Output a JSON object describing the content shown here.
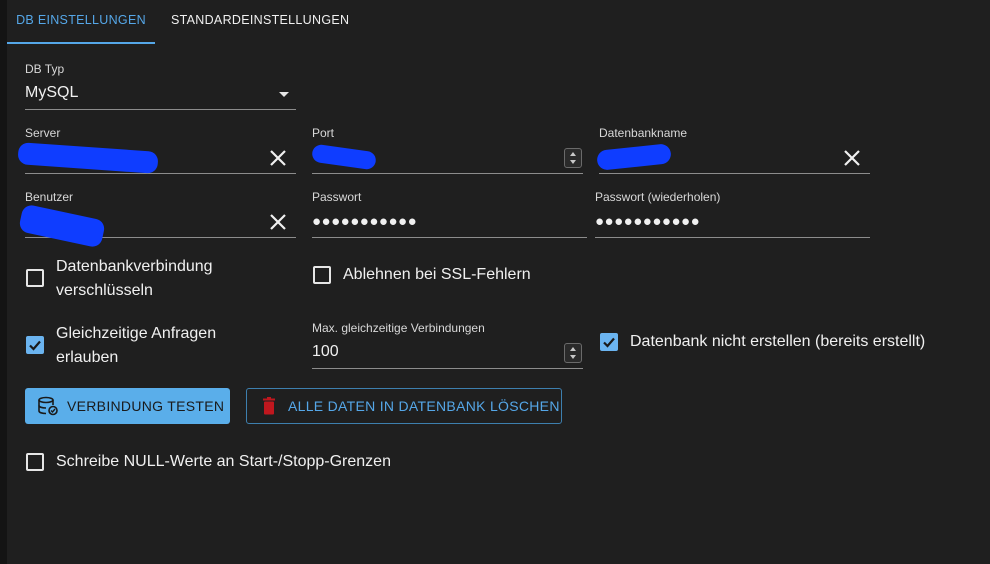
{
  "tabs": [
    {
      "label": "DB EINSTELLUNGEN"
    },
    {
      "label": "STANDARDEINSTELLUNGEN"
    }
  ],
  "db_type": {
    "label": "DB Typ",
    "value": "MySQL"
  },
  "server": {
    "label": "Server"
  },
  "port": {
    "label": "Port"
  },
  "dbname": {
    "label": "Datenbankname"
  },
  "user": {
    "label": "Benutzer"
  },
  "password": {
    "label": "Passwort",
    "value": "●●●●●●●●●●●"
  },
  "password_repeat": {
    "label": "Passwort (wiederholen)",
    "value": "●●●●●●●●●●●"
  },
  "checkboxes": {
    "encrypt": {
      "label_line1": "Datenbankverbindung",
      "label_line2": "verschlüsseln",
      "checked": false
    },
    "ssl": {
      "label": "Ablehnen bei SSL-Fehlern",
      "checked": false
    },
    "concurrent": {
      "label_line1": "Gleichzeitige Anfragen",
      "label_line2": "erlauben",
      "checked": true
    },
    "no_create": {
      "label": "Datenbank nicht erstellen (bereits erstellt)",
      "checked": true
    },
    "null_values": {
      "label": "Schreibe NULL-Werte an Start-/Stopp-Grenzen",
      "checked": false
    }
  },
  "max_connections": {
    "label": "Max. gleichzeitige Verbindungen",
    "value": "100"
  },
  "buttons": {
    "test": "VERBINDUNG TESTEN",
    "delete": "ALLE DATEN IN DATENBANK LÖSCHEN"
  },
  "colors": {
    "accent": "#55a7e8",
    "primary_button": "#5aaeea",
    "delete_icon": "#c0171e",
    "redaction": "#0f3dff"
  }
}
